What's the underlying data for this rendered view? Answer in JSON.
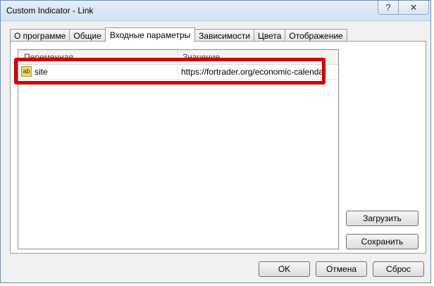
{
  "window": {
    "title": "Custom Indicator - Link",
    "help_icon_glyph": "?",
    "close_icon_glyph": "✕"
  },
  "tabs": [
    {
      "label": "О программе",
      "active": false
    },
    {
      "label": "Общие",
      "active": false
    },
    {
      "label": "Входные параметры",
      "active": true
    },
    {
      "label": "Зависимости",
      "active": false
    },
    {
      "label": "Цвета",
      "active": false
    },
    {
      "label": "Отображение",
      "active": false
    }
  ],
  "grid": {
    "columns": [
      "Переменная",
      "Значение"
    ],
    "rows": [
      {
        "icon": "ab",
        "name": "site",
        "value": "https://fortrader.org/economic-calendar"
      }
    ]
  },
  "buttons": {
    "load": "Загрузить",
    "save": "Сохранить",
    "ok": "OK",
    "cancel": "Отмена",
    "reset": "Сброс"
  },
  "colors": {
    "highlight": "#d20000",
    "window_border": "#6f8db5"
  }
}
